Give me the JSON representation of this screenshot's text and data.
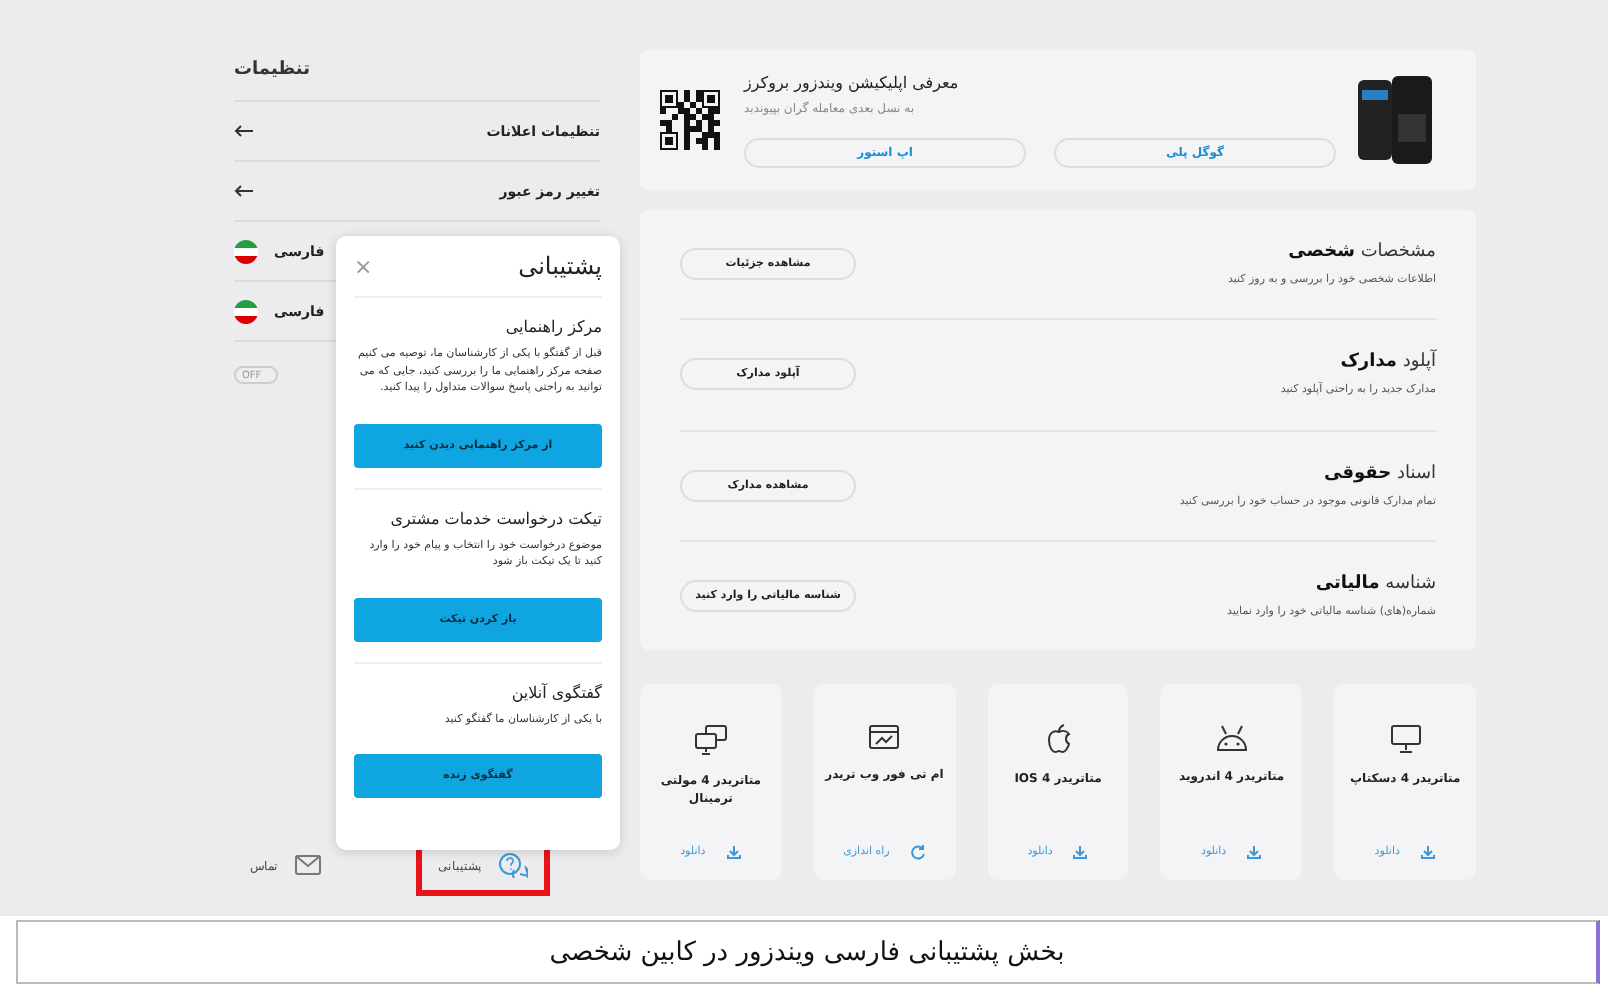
{
  "settings": {
    "title": "تنظیمات",
    "items": [
      {
        "kind": "link",
        "label": "تنظیمات اعلانات"
      },
      {
        "kind": "link",
        "label": "تغییر رمز عبور"
      },
      {
        "kind": "language",
        "label": "فارسی"
      },
      {
        "kind": "language",
        "label": "فارسی"
      }
    ],
    "toggle": {
      "label": "OFF",
      "on": false
    }
  },
  "bottom_nav": [
    {
      "kind": "support",
      "label": "پشتیبانی",
      "highlighted": true
    },
    {
      "kind": "contact",
      "label": "تماس",
      "highlighted": false
    }
  ],
  "support_popup": {
    "title": "پشتیبانی",
    "close": "×",
    "sections": [
      {
        "title": "مرکز راهنمایی",
        "description": "قبل از گفتگو با یکی از کارشناسان ما، توصیه می کنیم صفحه مرکز راهنمایی ما را بررسی کنید، جایی که می توانید به راحتی پاسخ سوالات متداول را پیدا کنید.",
        "button": "از مرکز راهنمایی دیدن کنید"
      },
      {
        "title": "تیکت درخواست خدمات مشتری",
        "description": "موضوع درخواست خود را انتخاب و پیام خود را وارد کنید تا یک تیکت باز شود",
        "button": "باز کردن تیکت"
      },
      {
        "title": "گفتگوی آنلاین",
        "description": "با یکی از کارشناسان ما گفتگو کنید",
        "button": "گفتگوی زنده"
      }
    ]
  },
  "app_banner": {
    "title": "معرفی اپلیکیشن ویندزور بروکرز",
    "subtitle": "به نسل بعدی معامله گران بپیوندید",
    "buttons": [
      "گوگل پلی",
      "اپ استور"
    ]
  },
  "profile": [
    {
      "title": "مشخصات **شخصی**",
      "description": "اطلاعات شخصی خود را بررسی و به روز کنید",
      "button": "مشاهده جزئیات"
    },
    {
      "title": "آپلود **مدارک**",
      "description": "مدارک جدید را به راحتی آپلود کنید",
      "button": "آپلود مدارک"
    },
    {
      "title": "اسناد **حقوقی**",
      "description": "تمام مدارک قانونی موجود در حساب خود را بررسی کنید",
      "button": "مشاهده مدارک"
    },
    {
      "title": "شناسه **مالیاتی**",
      "description": "شماره(های) شناسه مالیاتی خود را وارد نمایید",
      "button": "شناسه مالیاتی را وارد کنید"
    }
  ],
  "platforms": [
    {
      "kind": "desktop",
      "title": "متاتریدر 4 دسکتاپ",
      "action": {
        "kind": "download",
        "label": "دانلود"
      }
    },
    {
      "kind": "android",
      "title": "متاتریدر 4 اندروید",
      "action": {
        "kind": "download",
        "label": "دانلود"
      }
    },
    {
      "kind": "ios",
      "title": "متاتریدر 4 IOS",
      "action": {
        "kind": "download",
        "label": "دانلود"
      }
    },
    {
      "kind": "web",
      "title": "ام تی فور وب تریدر",
      "action": {
        "kind": "launch",
        "label": "راه اندازی"
      }
    },
    {
      "kind": "multi-terminal",
      "title": "متاتریدر 4 مولتی ترمینال",
      "action": {
        "kind": "download",
        "label": "دانلود"
      }
    }
  ],
  "caption": "بخش پشتیبانی فارسی ویندزور در کابین شخصی"
}
